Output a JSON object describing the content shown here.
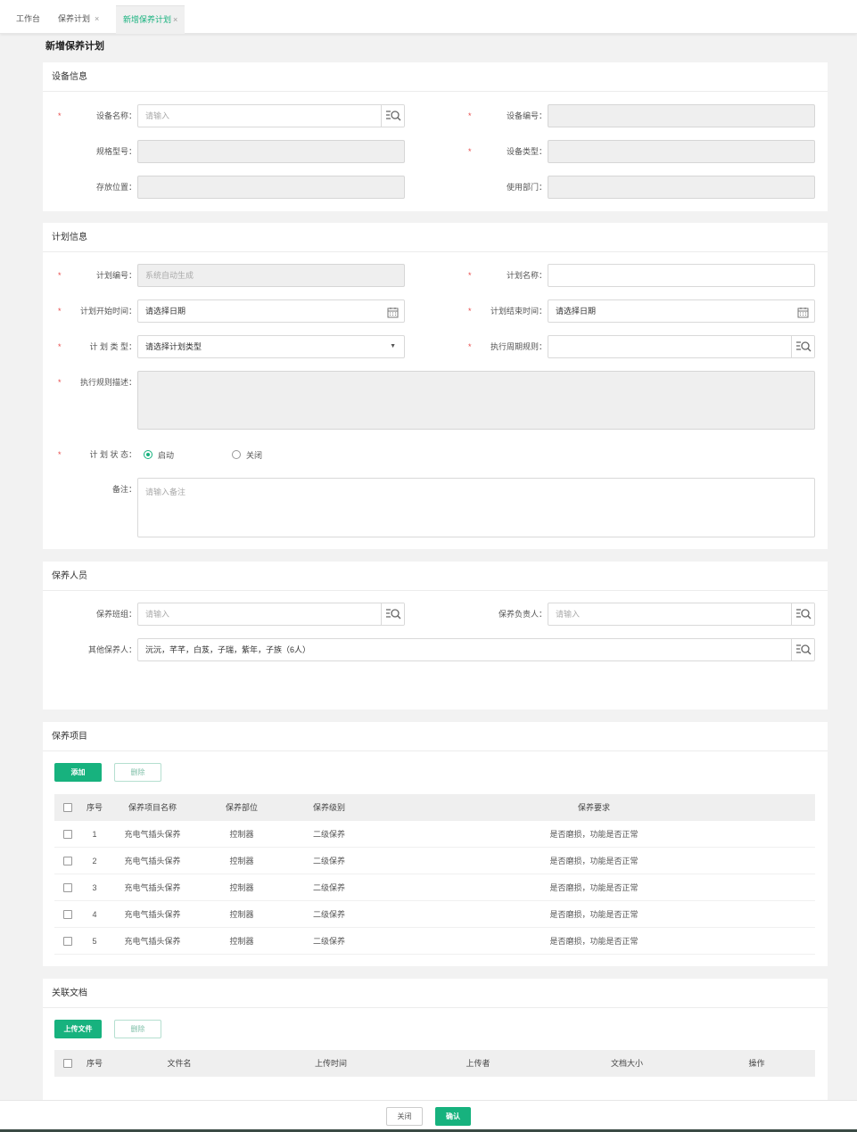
{
  "tabs": [
    {
      "label": "工作台",
      "closable": false
    },
    {
      "label": "保养计划",
      "closable": true
    },
    {
      "label": "新增保养计划",
      "closable": true,
      "active": true
    }
  ],
  "close_symbol": "×",
  "page_title": "新增保养计划",
  "required_mark": "*",
  "label_suffix": "：",
  "device_info": {
    "title": "设备信息",
    "device_name_label": "设备名称",
    "device_name_placeholder": "请输入",
    "device_no_label": "设备编号",
    "spec_label": "规格型号",
    "device_type_label": "设备类型",
    "location_label": "存放位置",
    "dept_label": "使用部门"
  },
  "plan_info": {
    "title": "计划信息",
    "plan_no_label": "计划编号",
    "plan_no_value": "系统自动生成",
    "plan_name_label": "计划名称",
    "start_label": "计划开始时间",
    "start_placeholder": "请选择日期",
    "end_label": "计划结束时间",
    "end_placeholder": "请选择日期",
    "type_label": "计 划 类 型",
    "type_placeholder": "请选择计划类型",
    "cycle_label": "执行周期规则",
    "rule_desc_label": "执行规则描述",
    "status_label": "计 划 状 态",
    "status_on": "启动",
    "status_off": "关闭",
    "remark_label": "备注",
    "remark_placeholder": "请输入备注"
  },
  "staff": {
    "title": "保养人员",
    "team_label": "保养班组",
    "team_placeholder": "请输入",
    "leader_label": "保养负责人",
    "leader_placeholder": "请输入",
    "others_label": "其他保养人",
    "others_value": "沅沅，芊芊，白芨，子瑞，紫年，子族（6人）"
  },
  "items": {
    "title": "保养项目",
    "add_label": "添加",
    "delete_label": "删除",
    "columns": [
      "序号",
      "保养项目名称",
      "保养部位",
      "保养级别",
      "保养要求"
    ],
    "rows": [
      [
        "1",
        "充电气插头保养",
        "控制器",
        "二级保养",
        "是否磨损，功能是否正常"
      ],
      [
        "2",
        "充电气插头保养",
        "控制器",
        "二级保养",
        "是否磨损，功能是否正常"
      ],
      [
        "3",
        "充电气插头保养",
        "控制器",
        "二级保养",
        "是否磨损，功能是否正常"
      ],
      [
        "4",
        "充电气插头保养",
        "控制器",
        "二级保养",
        "是否磨损，功能是否正常"
      ],
      [
        "5",
        "充电气插头保养",
        "控制器",
        "二级保养",
        "是否磨损，功能是否正常"
      ]
    ]
  },
  "docs": {
    "title": "关联文档",
    "upload_label": "上传文件",
    "delete_label": "删除",
    "columns": [
      "序号",
      "文件名",
      "上传时间",
      "上传者",
      "文档大小",
      "操作"
    ]
  },
  "footer": {
    "close_label": "关闭",
    "confirm_label": "确认"
  },
  "colors": {
    "accent": "#17b27e",
    "required": "#e84a4a"
  },
  "icons": [
    "close-icon",
    "lookup-search-icon",
    "calendar-icon",
    "chevron-down-icon"
  ]
}
